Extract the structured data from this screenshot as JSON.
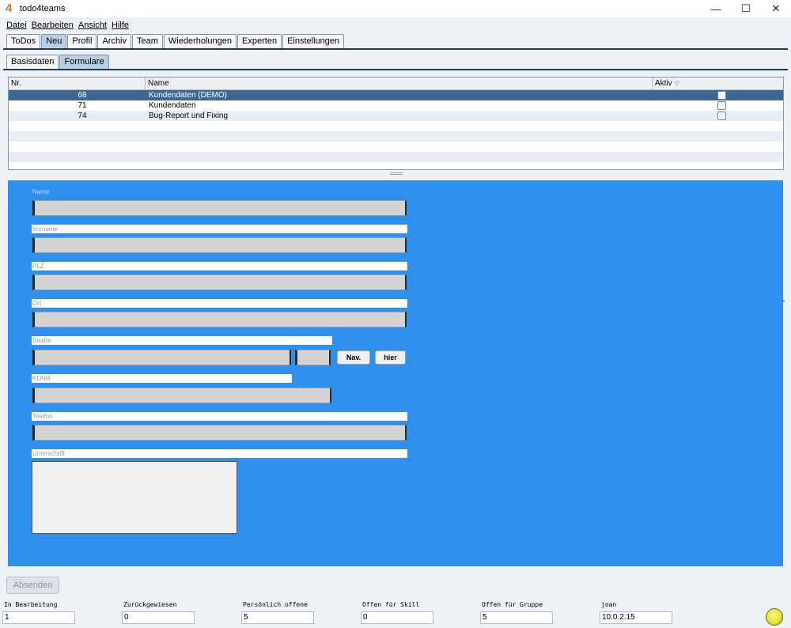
{
  "app": {
    "logo_char": "4",
    "title": "todo4teams"
  },
  "window_controls": {
    "minimize": "—",
    "maximize": "☐",
    "close": "✕"
  },
  "menu": [
    "Datei",
    "Bearbeiten",
    "Ansicht",
    "Hilfe"
  ],
  "main_tabs": [
    {
      "label": "ToDos",
      "active": false
    },
    {
      "label": "Neu",
      "active": true
    },
    {
      "label": "Profil",
      "active": false
    },
    {
      "label": "Archiv",
      "active": false
    },
    {
      "label": "Team",
      "active": false
    },
    {
      "label": "Wiederholungen",
      "active": false
    },
    {
      "label": "Experten",
      "active": false
    },
    {
      "label": "Einstellungen",
      "active": false
    }
  ],
  "sub_tabs": [
    {
      "label": "Basisdaten",
      "active": false
    },
    {
      "label": "Formulare",
      "active": true
    }
  ],
  "table": {
    "columns": {
      "nr": "Nr.",
      "name": "Name",
      "aktiv": "Aktiv"
    },
    "sort_icon": "sort-desc-icon",
    "rows": [
      {
        "nr": "68",
        "name": "Kundendaten (DEMO)",
        "selected": true
      },
      {
        "nr": "71",
        "name": "Kundendaten",
        "selected": false
      },
      {
        "nr": "74",
        "name": "Bug-Report und Fixing",
        "selected": false
      }
    ]
  },
  "form": {
    "background": "#2f8fec",
    "labels": {
      "name": "Name",
      "vorname": "Vorname",
      "plz": "PLZ",
      "ort": "Ort",
      "strasse": "Straße",
      "kdnr": "KDNR",
      "telefon": "Telefon",
      "unterschrift": "Unterschrift"
    },
    "buttons": {
      "nav": "Nav.",
      "hier": "hier"
    }
  },
  "actions": {
    "send": "Absenden"
  },
  "status": {
    "in_bearbeitung": {
      "label": "In Bearbeitung",
      "value": "1"
    },
    "zurueckgewiesen": {
      "label": "Zurückgewiesen",
      "value": "0"
    },
    "persoenlich_offene": {
      "label": "Persönlich offene",
      "value": "5"
    },
    "offen_skill": {
      "label": "Offen für Skill",
      "value": "0"
    },
    "offen_gruppe": {
      "label": "Offen für Gruppe",
      "value": "5"
    },
    "user": {
      "label": "joan",
      "value": "10.0.2.15"
    }
  }
}
